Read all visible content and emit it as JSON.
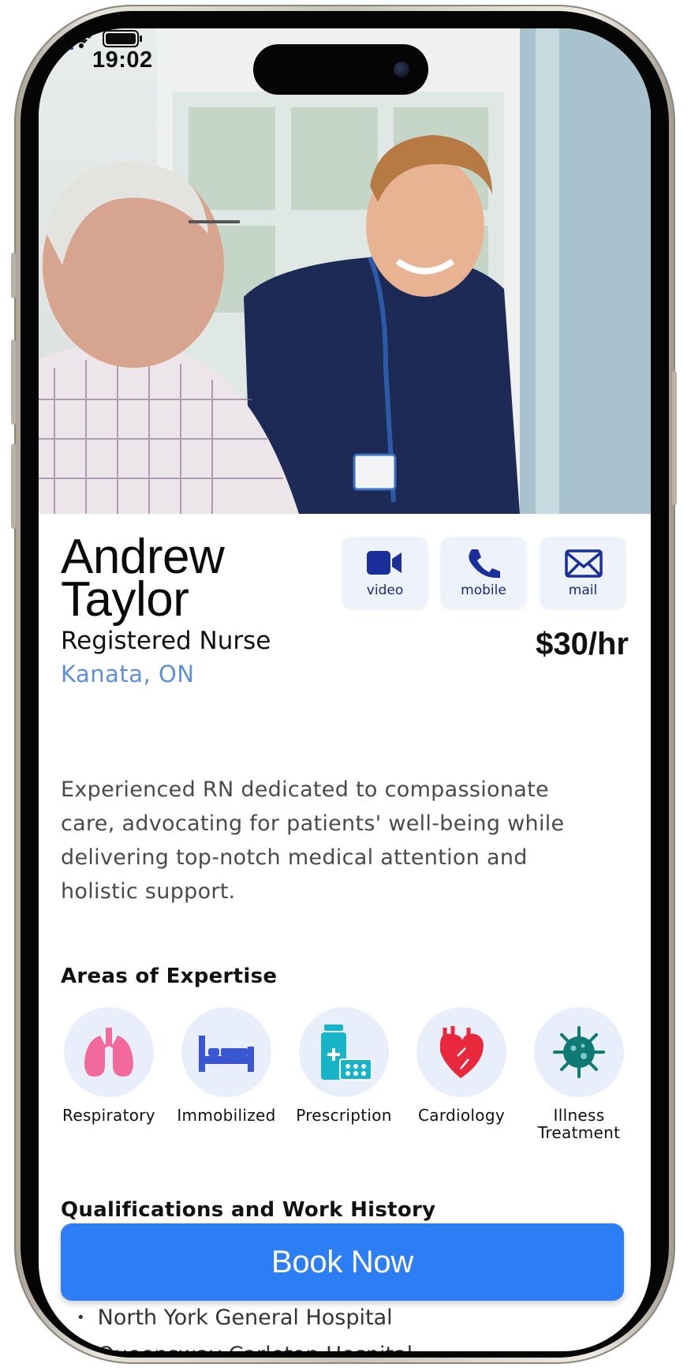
{
  "status_bar": {
    "time": "19:02"
  },
  "profile": {
    "first_name": "Andrew",
    "last_name": "Taylor",
    "role": "Registered Nurse",
    "location": "Kanata, ON",
    "rate": "$30/hr",
    "bio": "Experienced RN dedicated to compassionate care, advocating for patients' well-being while delivering top-notch medical attention and holistic support."
  },
  "contact": [
    {
      "label": "video",
      "icon": "video-camera-icon"
    },
    {
      "label": "mobile",
      "icon": "phone-icon"
    },
    {
      "label": "mail",
      "icon": "envelope-icon"
    }
  ],
  "expertise": {
    "title": "Areas of Expertise",
    "items": [
      {
        "label": "Respiratory",
        "icon": "lungs-icon"
      },
      {
        "label": "Immobilized",
        "icon": "bed-icon"
      },
      {
        "label": "Prescription",
        "icon": "pill-bottle-icon"
      },
      {
        "label": "Cardiology",
        "icon": "heart-icon"
      },
      {
        "label": "Illness Treatment",
        "icon": "virus-icon"
      }
    ]
  },
  "qualifications": {
    "title": "Qualifications and Work History",
    "items": [
      "North York General Hospital",
      "Queensway Carleton Hospital"
    ]
  },
  "book_button": "Book Now",
  "colors": {
    "accent": "#2d7ef5",
    "location": "#5f8fdb",
    "icon_blue": "#1a2f9a",
    "lungs": "#f26a9b",
    "bed": "#3a56d1",
    "pill": "#17b4c7",
    "heart": "#e8283d",
    "virus": "#0f7a73"
  }
}
